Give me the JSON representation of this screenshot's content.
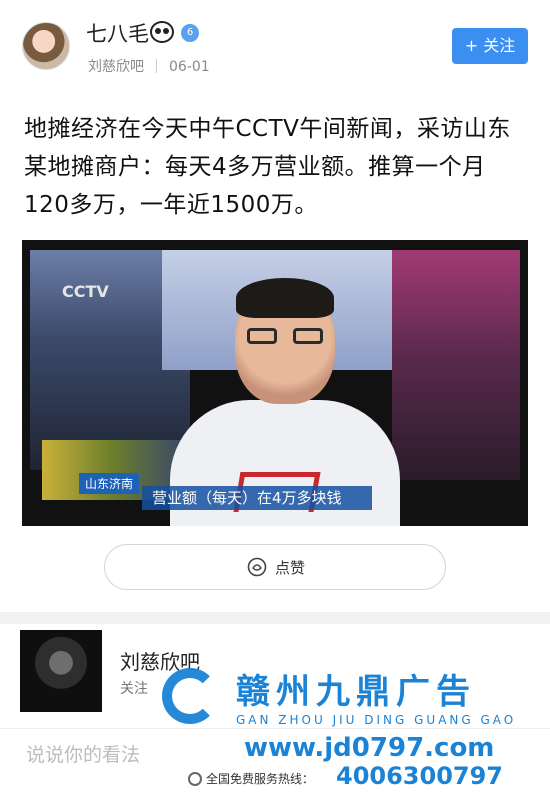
{
  "header": {
    "author": "七八毛",
    "verified_badge": "6",
    "source": "刘慈欣吧",
    "date": "06-01",
    "follow_label": "+ 关注"
  },
  "post": {
    "text": "地摊经济在今天中午CCTV午间新闻，采访山东某地摊商户：每天4多万营业额。推算一个月120多万，一年近1500万。"
  },
  "media": {
    "channel_bug": "CCTV",
    "location_tag": "山东济南",
    "caption": "营业额（每天）在4万多块钱"
  },
  "actions": {
    "like_label": "点赞"
  },
  "author_card": {
    "name": "刘慈欣吧",
    "follow_label": "关注"
  },
  "comment": {
    "placeholder": "说说你的看法"
  },
  "watermark": {
    "title": "赣州九鼎广告",
    "pinyin": "GAN ZHOU JIU DING GUANG GAO",
    "url": "www.jd0797.com",
    "hotline_label": "全国免费服务热线：",
    "phone": "4006300797"
  },
  "colors": {
    "accent": "#3b8ff0",
    "watermark_blue": "#1b83d6"
  }
}
